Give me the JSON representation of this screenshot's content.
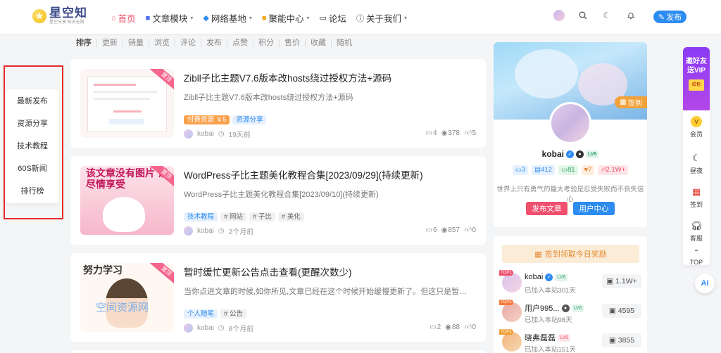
{
  "header": {
    "logo_title": "星空知",
    "logo_sub": "星空分享   知识无限",
    "nav": [
      {
        "icon": "home-icon",
        "label": "首页",
        "dropdown": false
      },
      {
        "icon": "article-icon",
        "label": "文章模块",
        "dropdown": true
      },
      {
        "icon": "network-icon",
        "label": "网络基地",
        "dropdown": true
      },
      {
        "icon": "gem-icon",
        "label": "聚能中心",
        "dropdown": true
      },
      {
        "icon": "forum-icon",
        "label": "论坛",
        "dropdown": false
      },
      {
        "icon": "info-icon",
        "label": "关于我们",
        "dropdown": true
      }
    ],
    "publish_label": "发布"
  },
  "sortbar": [
    "排序",
    "更新",
    "销量",
    "浏览",
    "评论",
    "发布",
    "点赞",
    "积分",
    "售价",
    "收藏",
    "随机"
  ],
  "left_menu": [
    "最新发布",
    "资源分享",
    "技术教程",
    "60S新闻",
    "排行榜"
  ],
  "posts": [
    {
      "title": "Zibll子比主题V7.6版本改hosts绕过授权方法+源码",
      "desc": "Zibll子比主题V7.6版本改hosts绕过授权方法+源码",
      "ribbon": "置顶",
      "tags": [
        {
          "text": "付费资源 ￥5",
          "style": "orange"
        },
        {
          "text": "资源分享",
          "style": "blue"
        }
      ],
      "author": "kobai",
      "time": "19天前",
      "comments": "4",
      "views": "378",
      "likes": "5"
    },
    {
      "title": "WordPress子比主题美化教程合集[2023/09/29](持续更新)",
      "desc": "WordPress子比主题美化教程合集[2023/09/10](持续更新)",
      "ribbon": "置顶",
      "thumb_text": "该文章没有图片 请尽情享受",
      "tags": [
        {
          "text": "技术教程",
          "style": "blue"
        },
        {
          "text": "# 网站",
          "style": "gray"
        },
        {
          "text": "# 子比",
          "style": "gray"
        },
        {
          "text": "# 美化",
          "style": "gray"
        }
      ],
      "author": "kobai",
      "time": "2个月前",
      "comments": "6",
      "views": "857",
      "likes": "0"
    },
    {
      "title": "暂时缓忙更新公告点击查看(更醒次数少)",
      "desc": "当你点进文章的时候,如你所见,文章已经在这个时候开始缓慢更新了。但这只是暂时的,服务器...",
      "ribbon": "置顶",
      "thumb_text": "努力学习",
      "watermark": "空间资源网",
      "tags": [
        {
          "text": "个人随笔",
          "style": "blue"
        },
        {
          "text": "# 公告",
          "style": "gray"
        }
      ],
      "author": "kobai",
      "time": "8个月前",
      "comments": "2",
      "views": "88",
      "likes": "0"
    }
  ],
  "user_card": {
    "sign_label": "签到",
    "name": "kobai",
    "level": "LV6",
    "counts": [
      {
        "icon": "comment-icon",
        "value": "3",
        "style": "b"
      },
      {
        "icon": "doc-icon",
        "value": "412",
        "style": "b"
      },
      {
        "icon": "message-icon",
        "value": "81",
        "style": "g"
      },
      {
        "icon": "heart-icon",
        "value": "7",
        "style": "o"
      },
      {
        "icon": "fire-icon",
        "value": "2.1W+",
        "style": "r"
      }
    ],
    "motto": "世界上只有勇气的最大考验是忍受失败而不丧失信心",
    "btn_publish": "发布文章",
    "btn_center": "用户中心"
  },
  "ranking": {
    "banner": "签到领取今日奖励",
    "rows": [
      {
        "name": "kobai",
        "days": "已加入本站301天",
        "value": "1.1W+"
      },
      {
        "name": "用户995...",
        "days": "已加入本站98天",
        "value": "4595"
      },
      {
        "name": "晓弗磊磊",
        "days": "已加入本站151天",
        "value": "3855"
      }
    ],
    "top_label": "TOP1"
  },
  "right_toolbar": {
    "vip_ad": [
      "邀好友",
      "送VIP"
    ],
    "coupon": "红包",
    "items": [
      {
        "icon": "vip-coin-icon",
        "label": "会员"
      },
      {
        "icon": "moon-icon",
        "label": "昼夜"
      },
      {
        "icon": "calendar-icon",
        "label": "签到"
      },
      {
        "icon": "headset-icon",
        "label": "客服"
      },
      {
        "icon": "arrow-up-icon",
        "label": "TOP"
      }
    ],
    "ai_label": "Ai"
  }
}
